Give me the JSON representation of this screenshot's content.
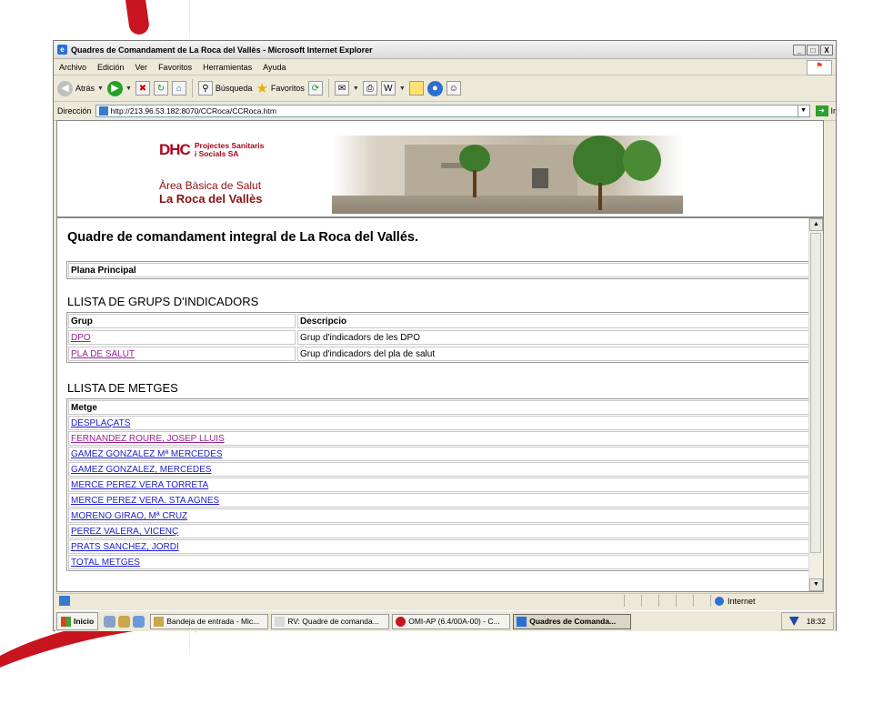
{
  "window": {
    "title": "Quadres de Comandament de La Roca del Vallès - Microsoft Internet Explorer",
    "buttons": [
      "_",
      "□",
      "X"
    ]
  },
  "menu": [
    "Archivo",
    "Edición",
    "Ver",
    "Favoritos",
    "Herramientas",
    "Ayuda"
  ],
  "toolbar": {
    "back_label": "Atrás",
    "search_label": "Búsqueda",
    "favorites_label": "Favoritos"
  },
  "address": {
    "label": "Dirección",
    "url": "http://213.96.53.182:8070/CCRoca/CCRoca.htm",
    "go_label": "Ir"
  },
  "banner": {
    "logo_mark": "DHC",
    "logo_line1": "Projectes Sanitaris",
    "logo_line2": "i Socials SA",
    "area_line1": "Àrea Bàsica de Salut",
    "area_line2": "La Roca del Vallès"
  },
  "page": {
    "title": "Quadre de comandament integral de La Roca del Vallés.",
    "plana": "Plana Principal",
    "groups_heading": "LLISTA DE GRUPS D'INDICADORS",
    "groups_header": {
      "grup": "Grup",
      "descripcio": "Descripcio"
    },
    "groups": [
      {
        "grup": "DPO",
        "descripcio": "Grup d'indicadors de les DPO"
      },
      {
        "grup": "PLA DE SALUT",
        "descripcio": "Grup d'indicadors del pla de salut"
      }
    ],
    "metges_heading": "LLISTA DE METGES",
    "metges_header": "Metge",
    "metges": [
      "DESPLAÇATS",
      "FERNANDEZ ROURE, JOSEP LLUIS",
      "GAMEZ GONZALEZ Mª MERCEDES",
      "GAMEZ GONZALEZ, MERCEDES",
      "MERCE PEREZ VERA TORRETA",
      "MERCE PEREZ VERA. STA AGNES",
      "MORENO GIRAO, Mª CRUZ",
      "PEREZ VALERA, VICENÇ",
      "PRATS SANCHEZ, JORDI",
      "TOTAL METGES"
    ]
  },
  "statusbar": {
    "zone": "Internet"
  },
  "taskbar": {
    "start": "Inicio",
    "tasks": [
      "Bandeja de entrada - Mic...",
      "RV: Quadre de comanda...",
      "OMI-AP (6.4/00A-00) - C...",
      "Quadres de Comanda..."
    ],
    "clock": "18:32"
  }
}
